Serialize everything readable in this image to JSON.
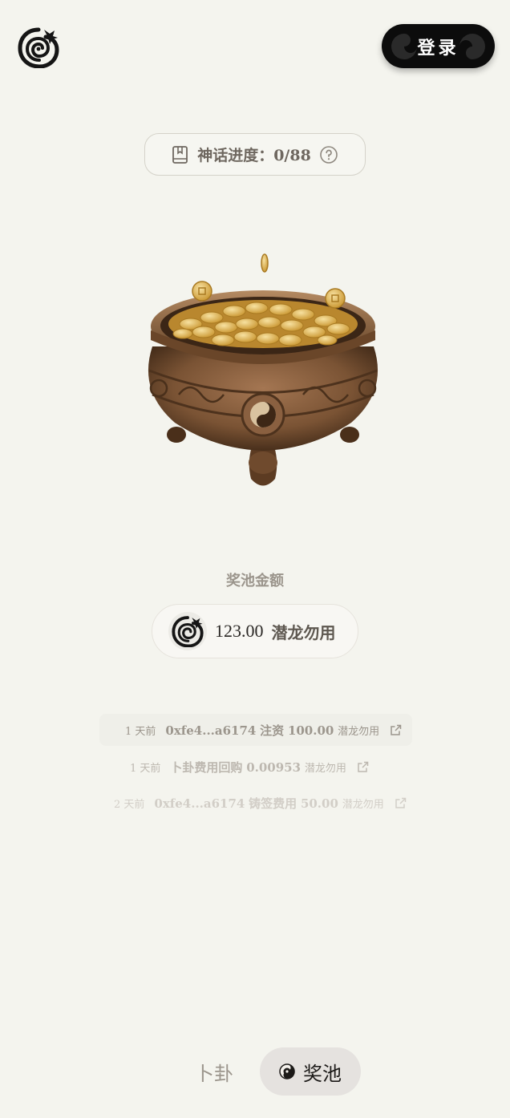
{
  "header": {
    "logo_icon": "dragon-coil-icon",
    "login_label": "登录"
  },
  "progress": {
    "label": "神话进度：0/88",
    "book_icon": "book-icon",
    "help_icon": "help-circle-icon"
  },
  "pool": {
    "label": "奖池金额",
    "amount": "123.00",
    "unit": "潜龙勿用"
  },
  "feed": [
    {
      "time": "1 天前",
      "address": "0xfe4...a6174",
      "action": "注资",
      "amount": "100.00",
      "unit": "潜龙勿用"
    },
    {
      "time": "1 天前",
      "address": "",
      "action": "卜卦费用回购",
      "amount": "0.00953",
      "unit": "潜龙勿用"
    },
    {
      "time": "2 天前",
      "address": "0xfe4...a6174",
      "action": "铸签费用",
      "amount": "50.00",
      "unit": "潜龙勿用"
    }
  ],
  "tabs": [
    {
      "label": "卜卦",
      "active": false
    },
    {
      "label": "奖池",
      "active": true
    }
  ],
  "colors": {
    "background": "#f4f4ee",
    "login_bg": "#0c0c0c",
    "cauldron_bronze": "#7a5334",
    "coin_gold": "#e2b84a"
  }
}
